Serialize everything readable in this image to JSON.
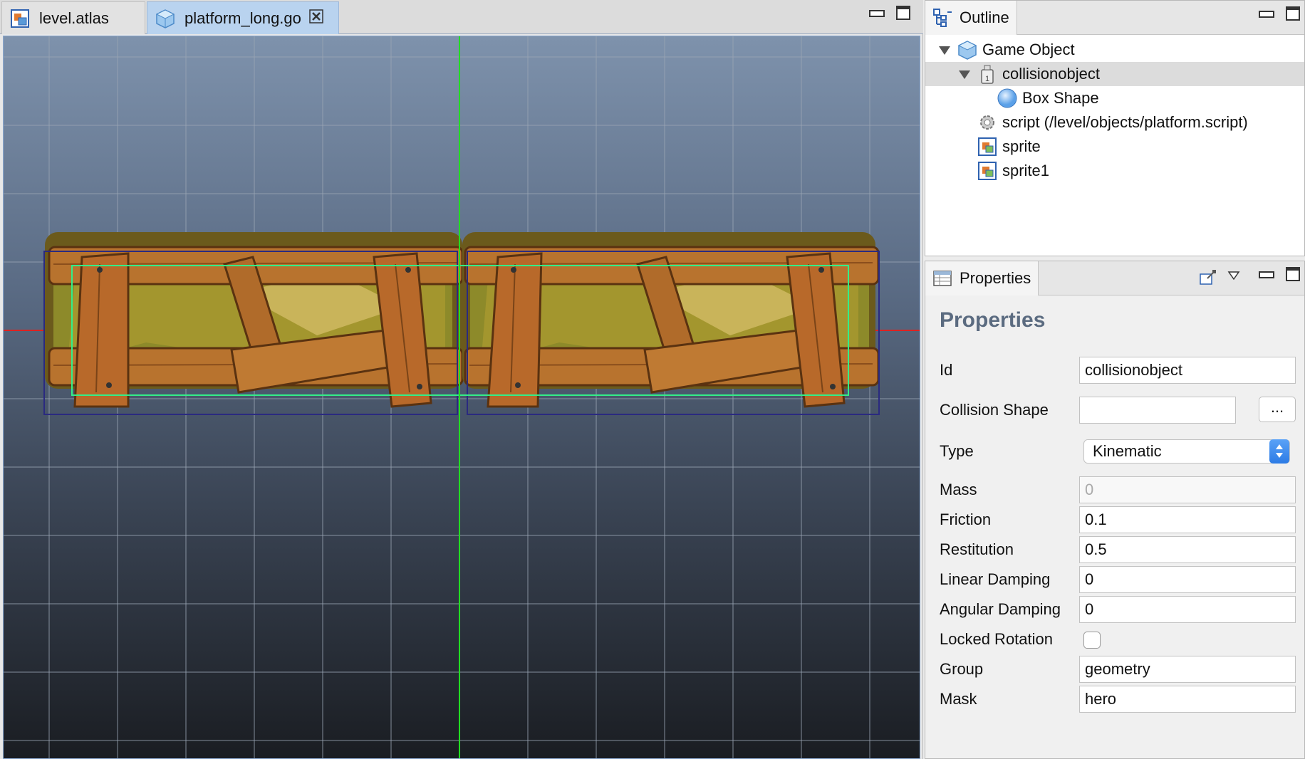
{
  "editor": {
    "tabs": [
      {
        "label": "level.atlas",
        "icon": "atlas-icon",
        "active": false
      },
      {
        "label": "platform_long.go",
        "icon": "game-object-icon",
        "active": true,
        "closable": true
      }
    ]
  },
  "outline": {
    "tab_label": "Outline",
    "tree": [
      {
        "label": "Game Object",
        "icon": "game-object-icon",
        "expanded": true,
        "level": 0
      },
      {
        "label": "collisionobject",
        "icon": "collision-object-icon",
        "expanded": true,
        "level": 1,
        "selected": true
      },
      {
        "label": "Box Shape",
        "icon": "box-shape-icon",
        "level": 2
      },
      {
        "label": "script (/level/objects/platform.script)",
        "icon": "script-gear-icon",
        "level": 1
      },
      {
        "label": "sprite",
        "icon": "sprite-icon",
        "level": 1
      },
      {
        "label": "sprite1",
        "icon": "sprite-icon",
        "level": 1
      }
    ]
  },
  "properties": {
    "tab_label": "Properties",
    "heading": "Properties",
    "fields": {
      "id": {
        "label": "Id",
        "value": "collisionobject"
      },
      "collision_shape": {
        "label": "Collision Shape",
        "value": "",
        "button": "..."
      },
      "type": {
        "label": "Type",
        "value": "Kinematic"
      },
      "mass": {
        "label": "Mass",
        "value": "0"
      },
      "friction": {
        "label": "Friction",
        "value": "0.1"
      },
      "restitution": {
        "label": "Restitution",
        "value": "0.5"
      },
      "linear_damping": {
        "label": "Linear Damping",
        "value": "0"
      },
      "angular_damping": {
        "label": "Angular Damping",
        "value": "0"
      },
      "locked_rotation": {
        "label": "Locked Rotation",
        "checked": false
      },
      "group": {
        "label": "Group",
        "value": "geometry"
      },
      "mask": {
        "label": "Mask",
        "value": "hero"
      }
    }
  },
  "colors": {
    "active_tab": "#b9d3ef",
    "axis_y": "#22dd22",
    "axis_x": "#dd2222",
    "selection_box": "#2a2a80",
    "collision_box": "#33ee88",
    "wood": "#b8732e",
    "heading": "#5b6b80",
    "select_arrows": "#2c7be5"
  }
}
